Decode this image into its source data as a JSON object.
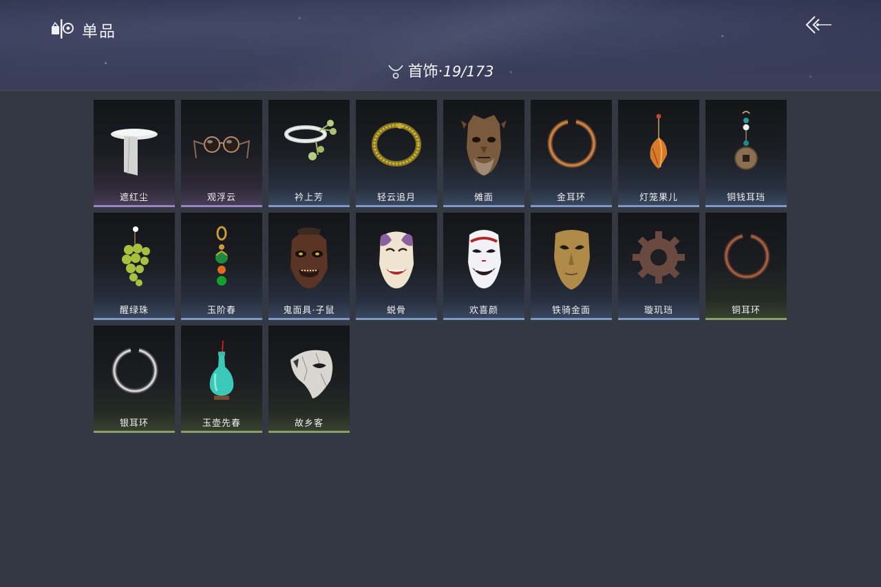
{
  "header": {
    "title": "单品",
    "category_name": "首饰",
    "separator": "·",
    "count": "19/173"
  },
  "items": [
    {
      "label": "遮红尘",
      "quality": "purple",
      "icon": "white-cloth-band-icon"
    },
    {
      "label": "观浮云",
      "quality": "purple",
      "icon": "round-glasses-icon"
    },
    {
      "label": "衿上芳",
      "quality": "blue",
      "icon": "flower-ring-icon"
    },
    {
      "label": "轻云追月",
      "quality": "blue",
      "icon": "gold-bracelet-icon"
    },
    {
      "label": "傩面",
      "quality": "blue",
      "icon": "nuo-mask-icon"
    },
    {
      "label": "金耳环",
      "quality": "blue",
      "icon": "gold-earring-icon"
    },
    {
      "label": "灯笼果儿",
      "quality": "blue",
      "icon": "lantern-fruit-icon"
    },
    {
      "label": "铜钱耳珰",
      "quality": "blue",
      "icon": "coin-earring-icon"
    },
    {
      "label": "醒绿珠",
      "quality": "blue",
      "icon": "green-grapes-icon"
    },
    {
      "label": "玉阶春",
      "quality": "blue",
      "icon": "jade-pendant-icon"
    },
    {
      "label": "鬼面具·子鼠",
      "quality": "blue",
      "icon": "rat-mask-icon"
    },
    {
      "label": "蜕骨",
      "quality": "blue",
      "icon": "opera-mask-icon"
    },
    {
      "label": "欢喜颜",
      "quality": "blue",
      "icon": "smiling-mask-icon"
    },
    {
      "label": "铁骑金面",
      "quality": "blue",
      "icon": "golden-mask-icon"
    },
    {
      "label": "璇玑珰",
      "quality": "blue",
      "icon": "gear-earring-icon"
    },
    {
      "label": "铜耳环",
      "quality": "green",
      "icon": "copper-earring-icon"
    },
    {
      "label": "银耳环",
      "quality": "green",
      "icon": "silver-earring-icon"
    },
    {
      "label": "玉壶先春",
      "quality": "green",
      "icon": "jade-vase-icon"
    },
    {
      "label": "故乡客",
      "quality": "green",
      "icon": "broken-mask-icon"
    }
  ],
  "colors": {
    "quality_purple": "#9b86c0",
    "quality_blue": "#7f9ac7",
    "quality_green": "#8aa068",
    "background": "#343842"
  }
}
